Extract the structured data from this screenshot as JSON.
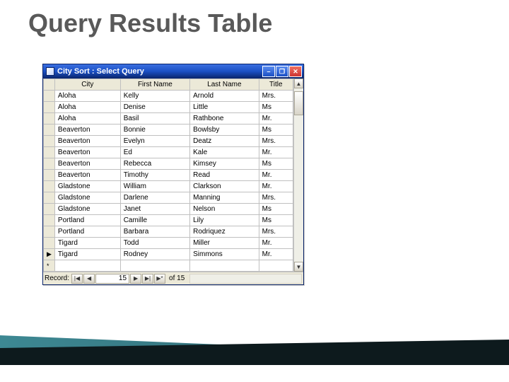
{
  "slide": {
    "title": "Query Results Table"
  },
  "window": {
    "title": "City Sort : Select Query",
    "min_glyph": "–",
    "max_glyph": "❐",
    "close_glyph": "✕",
    "scroll_up": "▲",
    "scroll_down": "▼"
  },
  "columns": [
    "City",
    "First Name",
    "Last Name",
    "Title"
  ],
  "rows": [
    {
      "sel": "",
      "city": "Aloha",
      "first": "Kelly",
      "last": "Arnold",
      "title": "Mrs."
    },
    {
      "sel": "",
      "city": "Aloha",
      "first": "Denise",
      "last": "Little",
      "title": "Ms"
    },
    {
      "sel": "",
      "city": "Aloha",
      "first": "Basil",
      "last": "Rathbone",
      "title": "Mr."
    },
    {
      "sel": "",
      "city": "Beaverton",
      "first": "Bonnie",
      "last": "Bowlsby",
      "title": "Ms"
    },
    {
      "sel": "",
      "city": "Beaverton",
      "first": "Evelyn",
      "last": "Deatz",
      "title": "Mrs."
    },
    {
      "sel": "",
      "city": "Beaverton",
      "first": "Ed",
      "last": "Kale",
      "title": "Mr."
    },
    {
      "sel": "",
      "city": "Beaverton",
      "first": "Rebecca",
      "last": "Kimsey",
      "title": "Ms"
    },
    {
      "sel": "",
      "city": "Beaverton",
      "first": "Timothy",
      "last": "Read",
      "title": "Mr."
    },
    {
      "sel": "",
      "city": "Gladstone",
      "first": "William",
      "last": "Clarkson",
      "title": "Mr."
    },
    {
      "sel": "",
      "city": "Gladstone",
      "first": "Darlene",
      "last": "Manning",
      "title": "Mrs."
    },
    {
      "sel": "",
      "city": "Gladstone",
      "first": "Janet",
      "last": "Nelson",
      "title": "Ms"
    },
    {
      "sel": "",
      "city": "Portland",
      "first": "Camille",
      "last": "Lily",
      "title": "Ms"
    },
    {
      "sel": "",
      "city": "Portland",
      "first": "Barbara",
      "last": "Rodriquez",
      "title": "Mrs."
    },
    {
      "sel": "",
      "city": "Tigard",
      "first": "Todd",
      "last": "Miller",
      "title": "Mr."
    },
    {
      "sel": "▶",
      "city": "Tigard",
      "first": "Rodney",
      "last": "Simmons",
      "title": "Mr."
    },
    {
      "sel": "*",
      "city": "",
      "first": "",
      "last": "",
      "title": ""
    }
  ],
  "nav": {
    "label": "Record:",
    "first": "|◀",
    "prev": "◀",
    "current": "15",
    "next": "▶",
    "last": "▶|",
    "new": "▶*",
    "of_text": "of  15"
  }
}
